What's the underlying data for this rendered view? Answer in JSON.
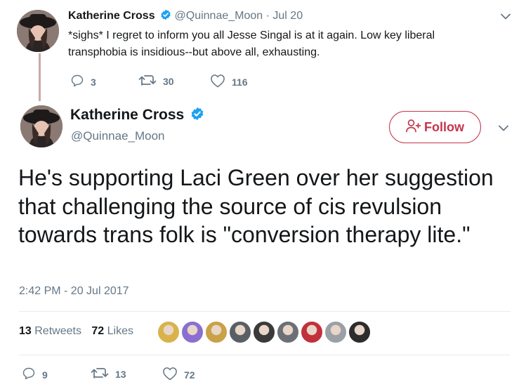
{
  "parent_tweet": {
    "author_name": "Katherine Cross",
    "author_handle": "@Quinnae_Moon",
    "separator": "·",
    "date": "Jul 20",
    "text": "*sighs* I regret to inform you all Jesse Singal is at it again. Low key liberal transphobia is insidious--but above all, exhausting.",
    "actions": {
      "replies": "3",
      "retweets": "30",
      "likes": "116"
    }
  },
  "main_tweet": {
    "author_name": "Katherine Cross",
    "author_handle": "@Quinnae_Moon",
    "follow_label": "Follow",
    "text": "He's supporting Laci Green over her suggestion that challenging the source of cis revulsion towards trans folk is \"conversion therapy lite.\"",
    "timestamp": "2:42 PM - 20 Jul 2017",
    "stats": {
      "retweets_count": "13",
      "retweets_label": "Retweets",
      "likes_count": "72",
      "likes_label": "Likes"
    },
    "likers": [
      "#d9b24a",
      "#8a6fd1",
      "#c9a146",
      "#5a5f66",
      "#3a3a3a",
      "#6d6f76",
      "#c2303b",
      "#9aa0a6",
      "#2c2c2c"
    ],
    "actions": {
      "replies": "9",
      "retweets": "13",
      "likes": "72"
    }
  },
  "colors": {
    "accent": "#c4354a",
    "verified": "#1da1f2",
    "muted": "#657786",
    "thread_line": "#c9a9a6"
  },
  "icons": [
    "verified-badge-icon",
    "chevron-down-icon",
    "reply-icon",
    "retweet-icon",
    "heart-icon",
    "follow-person-icon"
  ]
}
